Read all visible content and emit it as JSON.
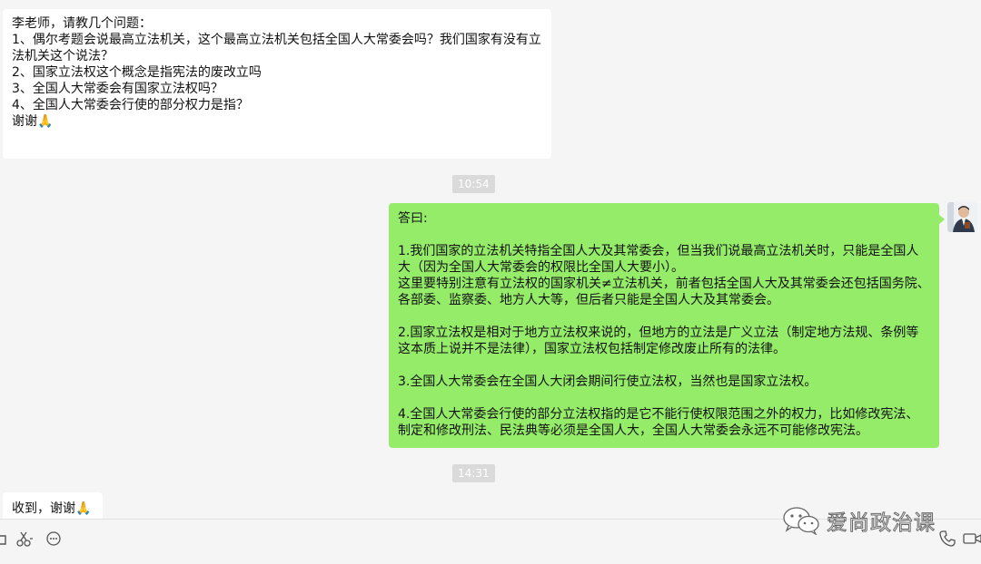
{
  "messages": [
    {
      "direction": "incoming",
      "text": "李老师，请教几个问题：\n1、偶尔考题会说最高立法机关，这个最高立法机关包括全国人大常委会吗？我们国家有没有立法机关这个说法？\n2、国家立法权这个概念是指宪法的废改立吗\n3、全国人大常委会有国家立法权吗？\n4、全国人大常委会行使的部分权力是指？\n谢谢🙏"
    },
    {
      "direction": "outgoing",
      "text": "答曰:\n\n1.我们国家的立法机关特指全国人大及其常委会，但当我们说最高立法机关时，只能是全国人大（因为全国人大常委会的权限比全国人大要小）。\n这里要特别注意有立法权的国家机关≠立法机关，前者包括全国人大及其常委会还包括国务院、各部委、监察委、地方人大等，但后者只能是全国人大及其常委会。\n\n2.国家立法权是相对于地方立法权来说的，但地方的立法是广义立法（制定地方法规、条例等这本质上说并不是法律），国家立法权包括制定修改废止所有的法律。\n\n3.全国人大常委会在全国人大闭会期间行使立法权，当然也是国家立法权。\n\n4.全国人大常委会行使的部分立法权指的是它不能行使权限范围之外的权力，比如修改宪法、制定和修改刑法、民法典等必须是全国人大，全国人大常委会永远不可能修改宪法。"
    },
    {
      "direction": "incoming",
      "text": "收到，谢谢🙏"
    }
  ],
  "timestamps": [
    "10:54",
    "14:31"
  ],
  "toolbar": {
    "icons": [
      "folder-icon",
      "scissors-icon",
      "chat-bubble-icon",
      "phone-icon",
      "video-call-icon"
    ]
  },
  "watermark": {
    "text": "爱尚政治课",
    "icon": "wechat-logo"
  },
  "colors": {
    "background": "#f5f5f5",
    "incoming_bubble": "#ffffff",
    "outgoing_bubble": "#95ec69",
    "timestamp_bg": "#dadada"
  }
}
